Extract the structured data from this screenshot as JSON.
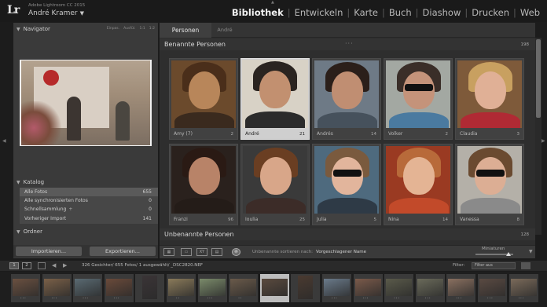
{
  "header": {
    "logo": "Lr",
    "app_title": "Adobe Lightroom CC 2015",
    "user_name": "André Kramer",
    "modules": [
      "Bibliothek",
      "Entwickeln",
      "Karte",
      "Buch",
      "Diashow",
      "Drucken",
      "Web"
    ],
    "active_module": "Bibliothek"
  },
  "navigator": {
    "title": "Navigator",
    "zoom_options": [
      "Einpas.",
      "Ausfül.",
      "1:1",
      "1:2"
    ]
  },
  "catalog": {
    "title": "Katalog",
    "items": [
      {
        "label": "Alle Fotos",
        "count": "655"
      },
      {
        "label": "Alle synchronisierten Fotos",
        "count": "0"
      },
      {
        "label": "Schnellsammlung",
        "plus": "+",
        "count": "0"
      },
      {
        "label": "Vorheriger Import",
        "count": "141"
      }
    ]
  },
  "ordner": {
    "title": "Ordner"
  },
  "buttons": {
    "import": "Importieren...",
    "export": "Exportieren..."
  },
  "tabs": {
    "active": "Personen",
    "inactive": "André"
  },
  "named_section": {
    "title": "Benannte Personen",
    "count": "198",
    "dots": "···"
  },
  "unnamed_section": {
    "title": "Unbenannte Personen",
    "count": "128"
  },
  "people": [
    {
      "name": "Amy (7)",
      "count": "2",
      "bg": "#6b4a2c",
      "skin": "#b8865a",
      "hair": "#4a2e1a",
      "shirt": "#3a2a1e"
    },
    {
      "name": "André",
      "count": "21",
      "bg": "#d8d2c6",
      "skin": "#c29070",
      "hair": "#2a2420",
      "shirt": "#2b2b2b",
      "selected": true
    },
    {
      "name": "Andrés",
      "count": "14",
      "bg": "#6e7a86",
      "skin": "#c08e72",
      "hair": "#2b1f1a",
      "shirt": "#46515c"
    },
    {
      "name": "Volker",
      "count": "2",
      "bg": "#a3a8a2",
      "skin": "#c4937a",
      "hair": "#3a2e28",
      "shirt": "#4a7aa0",
      "glasses": true
    },
    {
      "name": "Claudia",
      "count": "3",
      "bg": "#7e5a3a",
      "skin": "#e0b096",
      "hair": "#c8a060",
      "shirt": "#b02a34"
    },
    {
      "name": "Franzi",
      "count": "96",
      "bg": "#2a211d",
      "skin": "#b88368",
      "hair": "#2a1a14",
      "shirt": "#241c18"
    },
    {
      "name": "Ioulia",
      "count": "25",
      "bg": "#3a3a3a",
      "skin": "#d8a689",
      "hair": "#6a3e22",
      "shirt": "#3c2c28"
    },
    {
      "name": "Julia",
      "count": "5",
      "bg": "#4e6a7e",
      "skin": "#e2b59c",
      "hair": "#7a5a3e",
      "shirt": "#2e3a46",
      "glasses": true
    },
    {
      "name": "Nina",
      "count": "14",
      "bg": "#9a3a22",
      "skin": "#e4b494",
      "hair": "#b86a3a",
      "shirt": "#c24a2a"
    },
    {
      "name": "Vanessa",
      "count": "8",
      "bg": "#b4b0a8",
      "skin": "#dcae94",
      "hair": "#6a4a30",
      "shirt": "#8a8a8a",
      "glasses": true
    }
  ],
  "toolbar": {
    "sort_label": "Unbenannte sortieren nach:",
    "sort_value": "Vorgeschlagener Name",
    "thumb_label": "Miniaturen",
    "view_icons": [
      "grid-view-icon",
      "loupe-view-icon",
      "compare-view-icon",
      "survey-view-icon",
      "people-view-icon"
    ]
  },
  "filmstrip_bar": {
    "screens": [
      "1",
      "2"
    ],
    "status": "326 Gesichter/ 655 Fotos/ 1 ausgewählt/ _DSC2820.NEF",
    "filter_label": "Filter:",
    "filter_value": "Filter aus"
  },
  "filmstrip": [
    {
      "color": "#6a5040",
      "stars": "···"
    },
    {
      "color": "#7a6048",
      "stars": "···"
    },
    {
      "color": "#5a6a72",
      "stars": "···"
    },
    {
      "color": "#6a4a3a",
      "stars": "···"
    },
    {
      "color": "#3a3436",
      "stars": "",
      "tall": true
    },
    {
      "color": "#8a7a5a",
      "stars": "··"
    },
    {
      "color": "#7a8a6a",
      "stars": "···"
    },
    {
      "color": "#6a5a4a",
      "stars": "··"
    },
    {
      "color": "#5a4a3e",
      "stars": "··",
      "selected": true
    },
    {
      "color": "#4a3a30",
      "stars": "",
      "tall": true
    },
    {
      "color": "#6a7a8a",
      "stars": "···"
    },
    {
      "color": "#7a5a4a",
      "stars": "···"
    },
    {
      "color": "#5a5a4a",
      "stars": "···"
    },
    {
      "color": "#6a6a5a",
      "stars": "···"
    },
    {
      "color": "#8a7060",
      "stars": "···"
    },
    {
      "color": "#5a4a42",
      "stars": "···"
    },
    {
      "color": "#7a6a5a",
      "stars": "···"
    }
  ]
}
